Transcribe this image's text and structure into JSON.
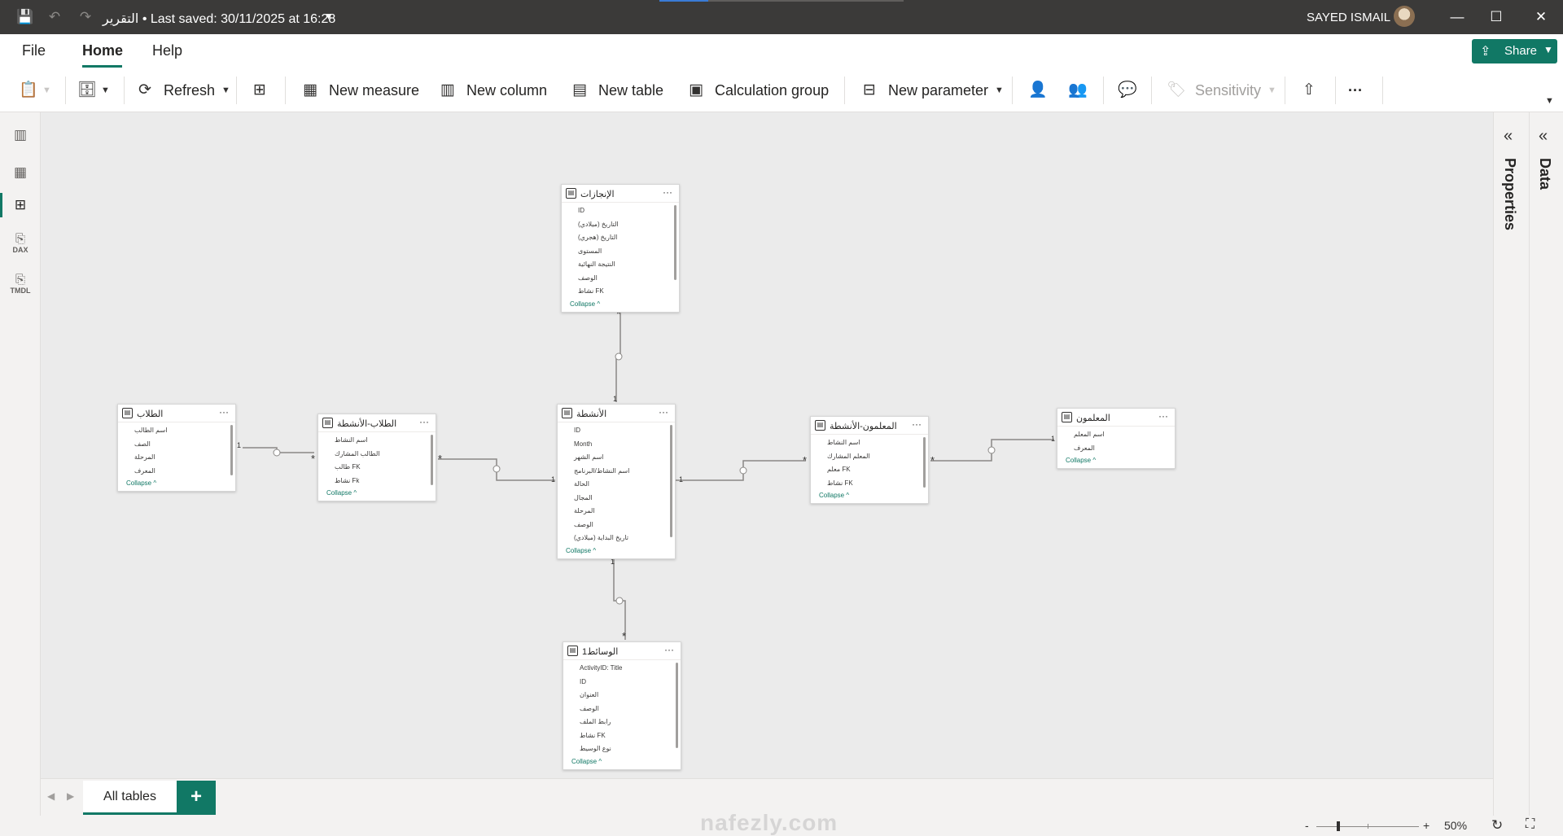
{
  "window": {
    "title": "التقرير",
    "last_saved": "• Last saved: 30/11/2025 at 16:28",
    "user_name": "SAYED ISMAIL",
    "progress": 0.2
  },
  "menu": {
    "tabs": [
      {
        "label": "File"
      },
      {
        "label": "Home"
      },
      {
        "label": "Help"
      }
    ],
    "share_label": "Share"
  },
  "ribbon": {
    "refresh": "Refresh",
    "new_measure": "New measure",
    "new_column": "New column",
    "new_table": "New table",
    "calculation_group": "Calculation group",
    "new_parameter": "New parameter",
    "sensitivity": "Sensitivity",
    "more": "···"
  },
  "leftnav": {
    "dax_label": "DAX",
    "tmdl_label": "TMDL"
  },
  "tables": {
    "achievements": {
      "name": "الإنجازات",
      "fields": [
        "ID",
        "التاريخ (ميلادي)",
        "التاريخ (هجري)",
        "المستوى",
        "النتيجة النهائية",
        "الوصف",
        "نشاط FK"
      ],
      "collapse": "Collapse ^"
    },
    "students": {
      "name": "الطلاب",
      "fields": [
        "اسم الطالب",
        "الصف",
        "المرحلة",
        "المعرف"
      ],
      "collapse": "Collapse ^"
    },
    "students_activities": {
      "name": "الطلاب-الأنشطة",
      "fields": [
        "اسم النشاط",
        "الطالب المشارك",
        "طالب FK",
        "نشاط Fk"
      ],
      "collapse": "Collapse ^"
    },
    "activities": {
      "name": "الأنشطة",
      "fields": [
        "ID",
        "Month",
        "اسم الشهر",
        "اسم النشاط/البرنامج",
        "الحالة",
        "المجال",
        "المرحلة",
        "الوصف",
        "تاريخ البداية (ميلادي)"
      ],
      "collapse": "Collapse ^"
    },
    "teachers_activities": {
      "name": "المعلمون-الأنشطة",
      "fields": [
        "اسم النشاط",
        "المعلم المشارك",
        "معلم FK",
        "نشاط FK"
      ],
      "collapse": "Collapse ^"
    },
    "teachers": {
      "name": "المعلمون",
      "fields": [
        "اسم المعلم",
        "المعرف"
      ],
      "collapse": "Collapse ^"
    },
    "media": {
      "name": "الوسائط1",
      "fields": [
        "ActivityID: Title",
        "ID",
        "العنوان",
        "الوصف",
        "رابط الملف",
        "نشاط FK",
        "نوع الوسيط"
      ],
      "collapse": "Collapse ^"
    }
  },
  "relationships": {
    "one": "1",
    "many": "*"
  },
  "panes": {
    "properties": "Properties",
    "data": "Data"
  },
  "bottom_tabs": {
    "all_tables": "All tables",
    "add": "+"
  },
  "status": {
    "zoom_minus": "-",
    "zoom_plus": "+",
    "zoom_level": "50%",
    "zoom_fraction": 0.2
  },
  "watermark": "nafezly.com"
}
